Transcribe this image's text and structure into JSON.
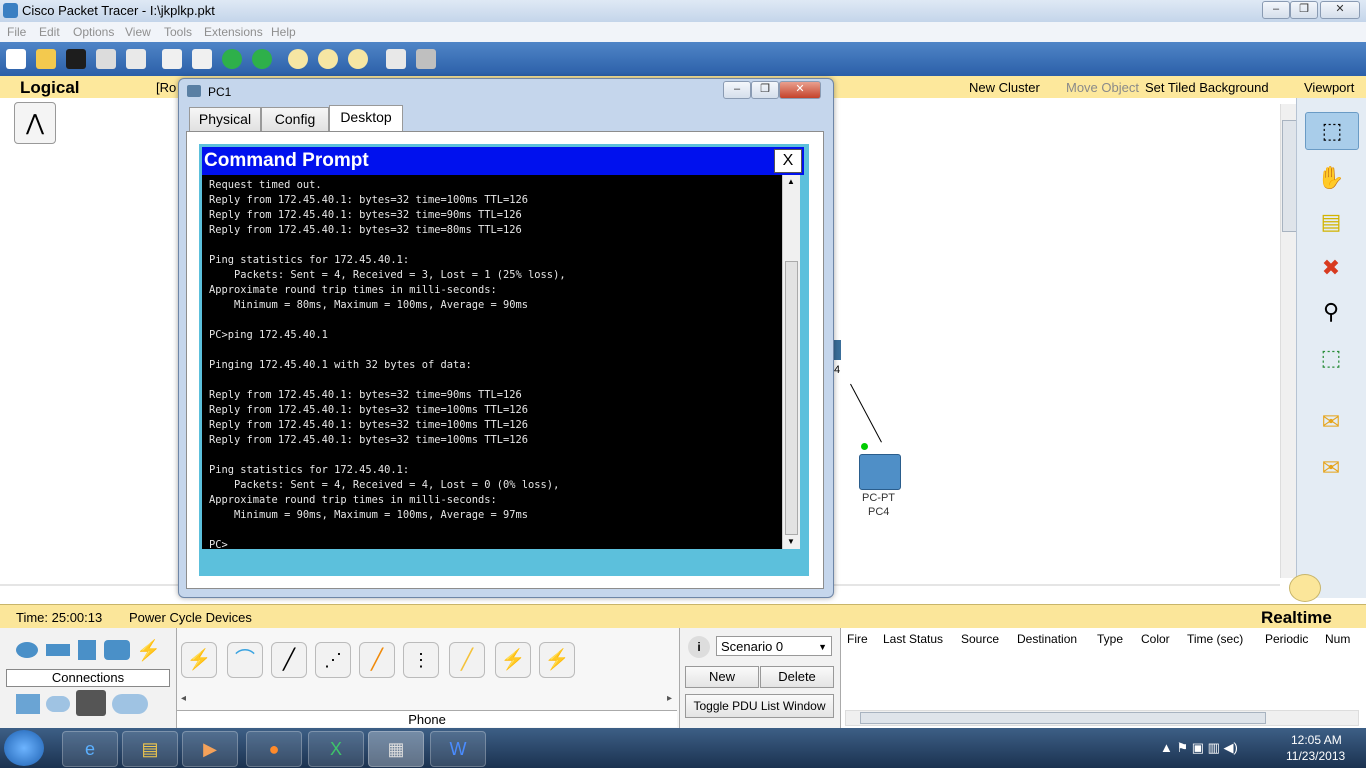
{
  "app": {
    "title": "Cisco Packet Tracer - I:\\jkplkp.pkt"
  },
  "menu": [
    "File",
    "Edit",
    "Options",
    "View",
    "Tools",
    "Extensions",
    "Help"
  ],
  "logical_bar": {
    "label": "Logical",
    "root_fragment": "[Ro",
    "new_cluster": "New Cluster",
    "move_object": "Move Object",
    "set_tiled_bg": "Set Tiled Background",
    "viewport": "Viewport"
  },
  "pc_window": {
    "title": "PC1",
    "tabs": [
      "Physical",
      "Config",
      "Desktop"
    ],
    "active_tab": "Desktop",
    "cmd_title": "Command Prompt",
    "cmd_close": "X",
    "cmd_lines": [
      "Request timed out.",
      "Reply from 172.45.40.1: bytes=32 time=100ms TTL=126",
      "Reply from 172.45.40.1: bytes=32 time=90ms TTL=126",
      "Reply from 172.45.40.1: bytes=32 time=80ms TTL=126",
      "",
      "Ping statistics for 172.45.40.1:",
      "    Packets: Sent = 4, Received = 3, Lost = 1 (25% loss),",
      "Approximate round trip times in milli-seconds:",
      "    Minimum = 80ms, Maximum = 100ms, Average = 90ms",
      "",
      "PC>ping 172.45.40.1",
      "",
      "Pinging 172.45.40.1 with 32 bytes of data:",
      "",
      "Reply from 172.45.40.1: bytes=32 time=90ms TTL=126",
      "Reply from 172.45.40.1: bytes=32 time=100ms TTL=126",
      "Reply from 172.45.40.1: bytes=32 time=100ms TTL=126",
      "Reply from 172.45.40.1: bytes=32 time=100ms TTL=126",
      "",
      "Ping statistics for 172.45.40.1:",
      "    Packets: Sent = 4, Received = 4, Lost = 0 (0% loss),",
      "Approximate round trip times in milli-seconds:",
      "    Minimum = 90ms, Maximum = 100ms, Average = 97ms",
      "",
      "PC>"
    ]
  },
  "workspace": {
    "device_label": "PC-PT",
    "device_name": "PC4",
    "port_fragment": "4"
  },
  "time_bar": {
    "time": "Time: 25:00:13",
    "power_cycle": "Power Cycle Devices",
    "mode": "Realtime"
  },
  "bottom": {
    "category": "Connections",
    "selected_type": "Phone",
    "scenario": "Scenario 0",
    "new_btn": "New",
    "delete_btn": "Delete",
    "toggle_pdu": "Toggle PDU List Window",
    "pdu_columns": [
      "Fire",
      "Last Status",
      "Source",
      "Destination",
      "Type",
      "Color",
      "Time (sec)",
      "Periodic",
      "Num"
    ]
  },
  "taskbar": {
    "time": "12:05 AM",
    "date": "11/23/2013"
  },
  "colors": {
    "toolbar": "#2b5fa8",
    "logical_bar": "#fde89c",
    "cmd_header": "#0011ee",
    "cmd_frame": "#5cc0dc"
  }
}
